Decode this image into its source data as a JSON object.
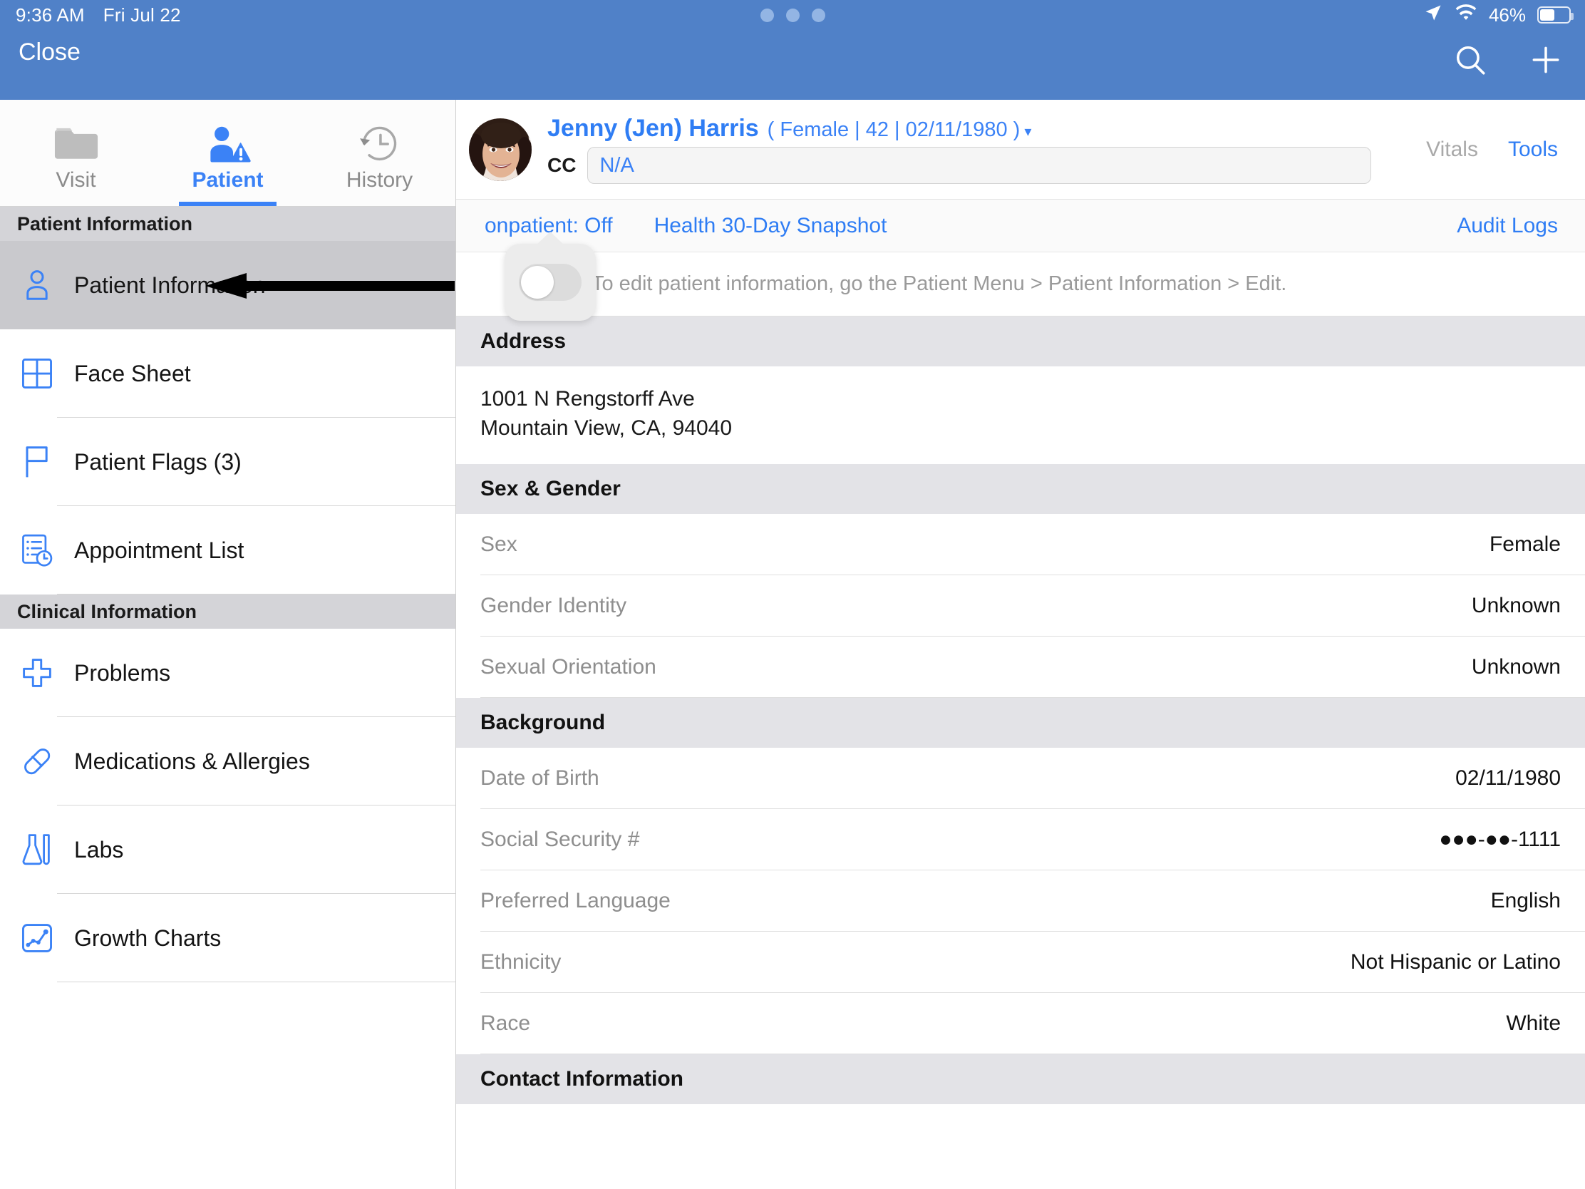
{
  "status_bar": {
    "time": "9:36 AM",
    "date": "Fri Jul 22",
    "battery_percent": "46%"
  },
  "topbar": {
    "close_label": "Close"
  },
  "tabs": [
    {
      "label": "Visit",
      "icon": "folder-icon",
      "active": false
    },
    {
      "label": "Patient",
      "icon": "person-warning-icon",
      "active": true
    },
    {
      "label": "History",
      "icon": "clock-history-icon",
      "active": false
    }
  ],
  "sidebar": {
    "sections": [
      {
        "title": "Patient Information",
        "items": [
          {
            "label": "Patient Information",
            "icon": "person-outline-icon",
            "selected": true
          },
          {
            "label": "Face Sheet",
            "icon": "grid-icon",
            "selected": false
          },
          {
            "label": "Patient Flags (3)",
            "icon": "flag-icon",
            "selected": false
          },
          {
            "label": "Appointment List",
            "icon": "appointment-list-icon",
            "selected": false
          }
        ]
      },
      {
        "title": "Clinical Information",
        "items": [
          {
            "label": "Problems",
            "icon": "cross-icon",
            "selected": false
          },
          {
            "label": "Medications & Allergies",
            "icon": "pill-icon",
            "selected": false
          },
          {
            "label": "Labs",
            "icon": "flask-icon",
            "selected": false
          },
          {
            "label": "Growth Charts",
            "icon": "growth-chart-icon",
            "selected": false
          }
        ]
      }
    ]
  },
  "patient_header": {
    "name": "Jenny (Jen) Harris",
    "demographics": "( Female | 42 | 02/11/1980 )",
    "cc_label": "CC",
    "cc_value": "",
    "cc_placeholder": "N/A",
    "vitals_label": "Vitals",
    "tools_label": "Tools"
  },
  "toolbar": {
    "onpatient_label": "onpatient: Off",
    "snapshot_label": "Health 30-Day Snapshot",
    "audit_logs_label": "Audit Logs",
    "onpatient_toggle_state": "off"
  },
  "hint": {
    "text": "To edit patient information, go the Patient Menu > Patient Information > Edit."
  },
  "sections": [
    {
      "title": "Address",
      "type": "address",
      "lines": [
        "1001 N Rengstorff Ave",
        "Mountain View, CA, 94040"
      ]
    },
    {
      "title": "Sex & Gender",
      "type": "rows",
      "rows": [
        {
          "key": "Sex",
          "value": "Female"
        },
        {
          "key": "Gender Identity",
          "value": "Unknown"
        },
        {
          "key": "Sexual Orientation",
          "value": "Unknown"
        }
      ]
    },
    {
      "title": "Background",
      "type": "rows",
      "rows": [
        {
          "key": "Date of Birth",
          "value": "02/11/1980"
        },
        {
          "key": "Social Security #",
          "value": "●●●-●●-1111",
          "masked": true
        },
        {
          "key": "Preferred Language",
          "value": "English"
        },
        {
          "key": "Ethnicity",
          "value": "Not Hispanic or Latino"
        },
        {
          "key": "Race",
          "value": "White"
        }
      ]
    },
    {
      "title": "Contact Information",
      "type": "rows",
      "rows": []
    }
  ],
  "colors": {
    "header_blue": "#5081c8",
    "accent_blue": "#2f7df4",
    "section_grey": "#e3e3e7",
    "sidebar_header_grey": "#d4d4d8",
    "selected_row_grey": "#c9c9cd"
  }
}
